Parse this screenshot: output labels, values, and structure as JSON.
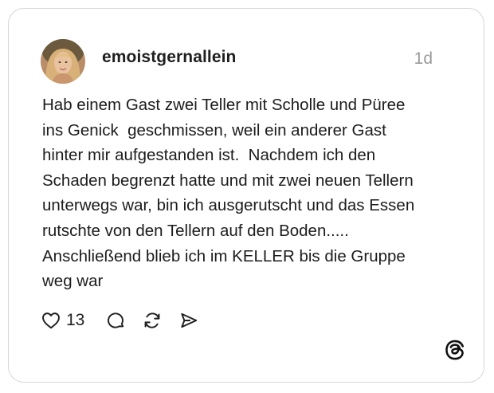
{
  "post": {
    "username": "emoistgernallein",
    "timestamp": "1d",
    "text_lines": [
      "Hab einem Gast zwei Teller mit Scholle und Püree",
      "ins Genick  geschmissen, weil ein anderer Gast",
      "hinter mir aufgestanden ist.  Nachdem ich den",
      "Schaden begrenzt hatte und mit zwei neuen Tellern",
      "unterwegs war, bin ich ausgerutscht und das Essen",
      "rutschte von den Tellern auf den Boden.....",
      "Anschließend blieb ich im KELLER bis die Gruppe",
      "weg war"
    ],
    "like_count": "13"
  },
  "icons": {
    "like": "heart-icon",
    "comment": "comment-bubble-icon",
    "repost": "repost-icon",
    "share": "send-icon",
    "brand": "threads-logo-icon"
  },
  "colors": {
    "text": "#1c1c1c",
    "muted": "#9a9a9a",
    "border": "#d6d6d6"
  }
}
